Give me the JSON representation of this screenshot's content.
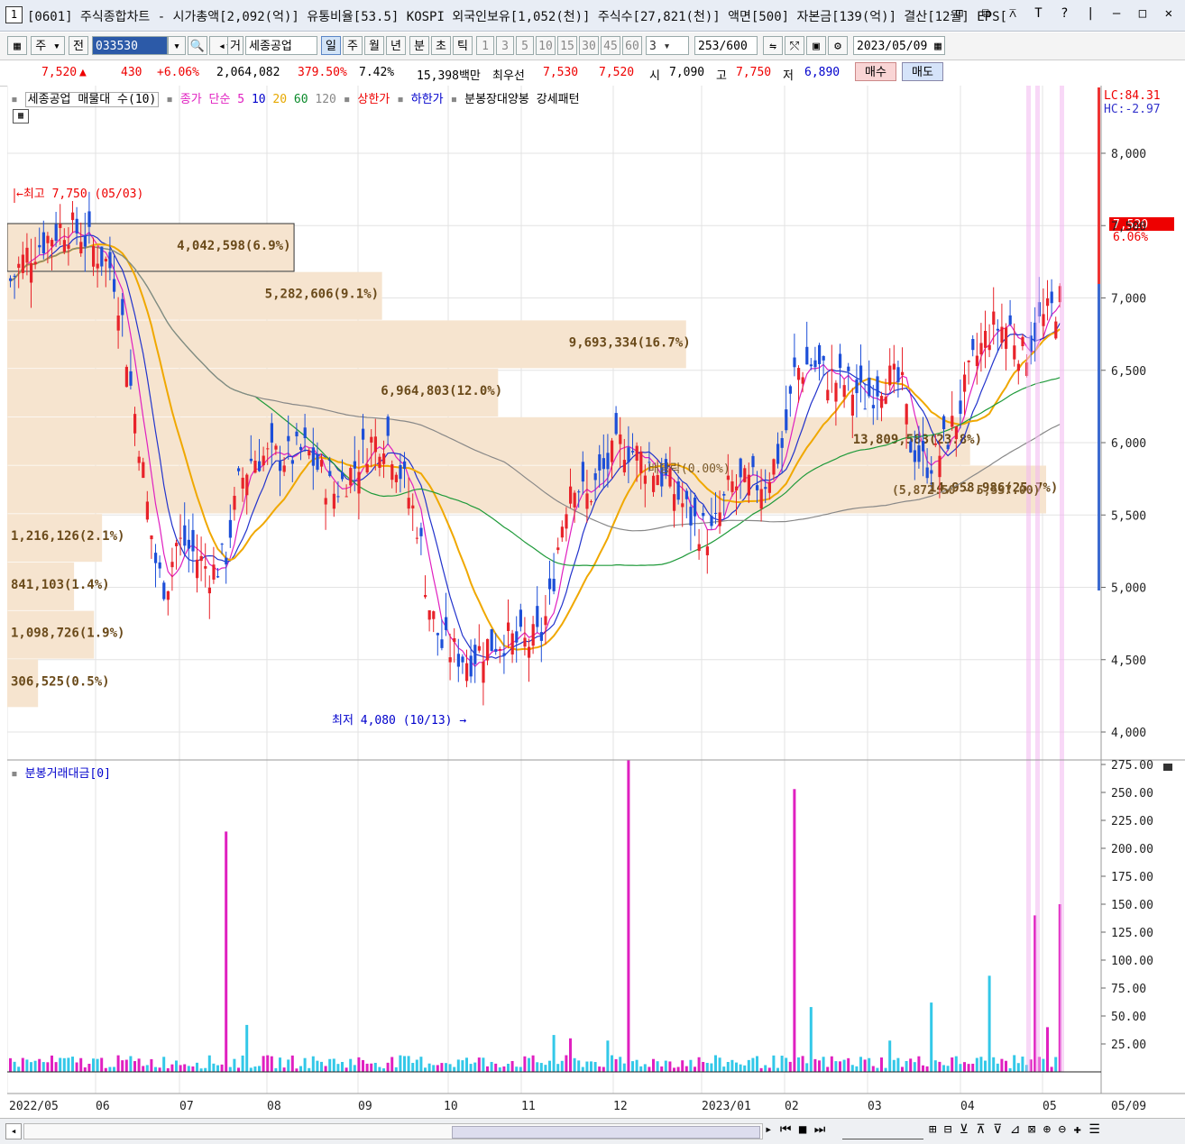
{
  "window": {
    "number": "1",
    "title": "[0601] 주식종합차트 - 시가총액[2,092(억)] 유통비율[53.5] KOSPI 외국인보유[1,052(천)] 주식수[27,821(천)] 액면[500] 자본금[139(억)] 결산[12월] EPS[",
    "buttons": "⊡ ⧉ ⊼ T ? | — □ ✕"
  },
  "toolbar": {
    "market": "주",
    "all": "전",
    "code": "033530",
    "mode": "거",
    "name": "세종공업",
    "periods": [
      "일",
      "주",
      "월",
      "년",
      "분",
      "초",
      "틱"
    ],
    "selected_period": "일",
    "intervals": [
      "1",
      "3",
      "5",
      "10",
      "15",
      "30",
      "45",
      "60"
    ],
    "interval_value": "3",
    "count": "253",
    "count_max": "/600",
    "date": "2023/05/09"
  },
  "quote": {
    "price": "7,520",
    "arrow": "▲",
    "change": "430",
    "change_pct": "+6.06%",
    "volume": "2,064,082",
    "vol_ratio": "379.50%",
    "turnover": "7.42%",
    "amount": "15,398백만",
    "best_ask_label": "최우선",
    "best_ask": "7,530",
    "best_bid": "7,520",
    "open_label": "시",
    "open": "7,090",
    "high_label": "고",
    "high": "7,750",
    "low_label": "저",
    "low": "6,890",
    "buy": "매수",
    "sell": "매도"
  },
  "legend_top": {
    "vp": "세종공업 매물대 수(10)",
    "ma_label": "종가 단순 5",
    "ma10": "10",
    "ma20": "20",
    "ma60": "60",
    "ma120": "120",
    "upper": "상한가",
    "lower": "하한가",
    "pattern": "분봉장대양봉 강세패턴"
  },
  "legend_bottom": {
    "label": "분봉거래대금[0]"
  },
  "price_axis": {
    "ticks": [
      "8,000",
      "7,500",
      "7,000",
      "6,500",
      "6,000",
      "5,500",
      "5,000",
      "4,500",
      "4,000"
    ],
    "lc": "LC:84.31",
    "hc": "HC:-2.97",
    "current": "7,520",
    "current_pct": "6.06%"
  },
  "volume_axis": {
    "ticks": [
      "275.00",
      "250.00",
      "225.00",
      "200.00",
      "175.00",
      "150.00",
      "125.00",
      "100.00",
      "75.00",
      "50.00",
      "25.00"
    ]
  },
  "date_axis": {
    "labels": [
      "2022/05",
      "06",
      "07",
      "08",
      "09",
      "10",
      "11",
      "12",
      "2023/01",
      "02",
      "03",
      "04",
      "05",
      "05/09"
    ]
  },
  "annotations": {
    "high": "←최고 7,750 (05/03)",
    "low": "최저 4,080 (10/13) →",
    "dividend": "배당락(0.00%)",
    "range": "(5,872.50 ~ 5,537.00)"
  },
  "chart_data": {
    "type": "candlestick",
    "title": "세종공업",
    "volume_profile": [
      {
        "label": "4,042,598(6.9%)",
        "pct": 6.9
      },
      {
        "label": "5,282,606(9.1%)",
        "pct": 9.1
      },
      {
        "label": "9,693,334(16.7%)",
        "pct": 16.7
      },
      {
        "label": "6,964,803(12.0%)",
        "pct": 12.0
      },
      {
        "label": "13,809,583(23.8%)",
        "pct": 23.8
      },
      {
        "label": "14,958,986(25.7%)",
        "pct": 25.7
      },
      {
        "label": "1,216,126(2.1%)",
        "pct": 2.1
      },
      {
        "label": "841,103(1.4%)",
        "pct": 1.4
      },
      {
        "label": "1,098,726(1.9%)",
        "pct": 1.9
      },
      {
        "label": "306,525(0.5%)",
        "pct": 0.5
      }
    ],
    "price_range": [
      4000,
      8200
    ],
    "high": 7750,
    "low": 4080,
    "last": 7520,
    "volume_range": [
      0,
      275
    ]
  },
  "statusbar": {
    "controls": "▸ ⏮ ■ ⏭",
    "tools": "⊞ ⊟ ⊻ ⊼ ⊽ ⊿ ⊠ ⊕ ⊖ ✚ ☰"
  }
}
